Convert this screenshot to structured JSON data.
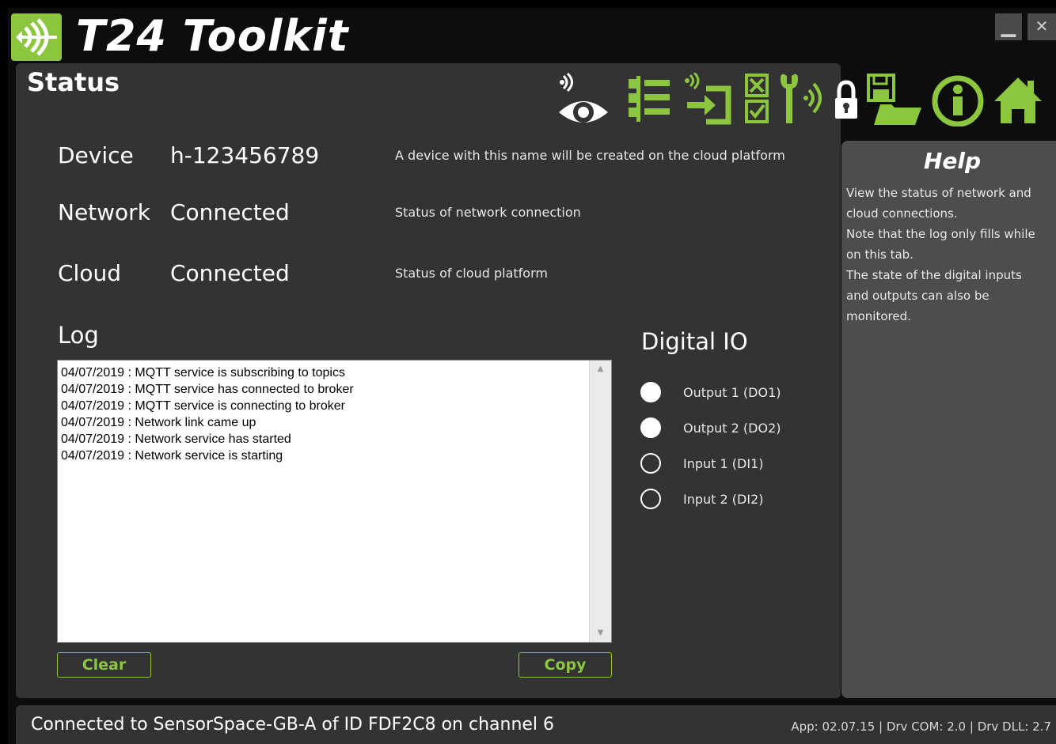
{
  "app": {
    "title": "T24 Toolkit",
    "accent_color": "#8cc63f",
    "window_controls": {
      "minimize_label": "▁",
      "close_label": "✕"
    }
  },
  "page": {
    "title": "Status"
  },
  "toolbar": {
    "icons": [
      "wireless-eye-icon",
      "settings-list-icon",
      "wireless-import-icon",
      "checklist-icon",
      "wireless-wrench-icon",
      "lock-icon",
      "save-open-icon",
      "info-icon",
      "home-icon"
    ]
  },
  "fields": [
    {
      "label": "Device",
      "value": "h-123456789",
      "hint": "A device with this name will be created on the cloud platform"
    },
    {
      "label": "Network",
      "value": "Connected",
      "hint": "Status of network connection"
    },
    {
      "label": "Cloud",
      "value": "Connected",
      "hint": "Status of cloud platform"
    }
  ],
  "log": {
    "heading": "Log",
    "lines": [
      "04/07/2019 : MQTT service is subscribing to topics",
      "04/07/2019 : MQTT service has connected to broker",
      "04/07/2019 : MQTT service is connecting to broker",
      "04/07/2019 : Network link came up",
      "04/07/2019 : Network service has started",
      "04/07/2019 : Network service is starting"
    ],
    "clear_label": "Clear",
    "copy_label": "Copy"
  },
  "digital_io": {
    "heading": "Digital IO",
    "items": [
      {
        "label": "Output 1 (DO1)",
        "state": "on"
      },
      {
        "label": "Output 2 (DO2)",
        "state": "on"
      },
      {
        "label": "Input 1 (DI1)",
        "state": "off"
      },
      {
        "label": "Input 2 (DI2)",
        "state": "off"
      }
    ]
  },
  "help": {
    "title": "Help",
    "lines": [
      "View the status of network and",
      "cloud connections.",
      "Note that the log only fills while",
      "on this tab.",
      "The state of the digital inputs",
      "and outputs can also be",
      "monitored."
    ]
  },
  "status_bar": {
    "message": "Connected to SensorSpace-GB-A of ID FDF2C8 on channel 6",
    "version": "App: 02.07.15 | Drv COM: 2.0 | Drv DLL: 2.7"
  }
}
